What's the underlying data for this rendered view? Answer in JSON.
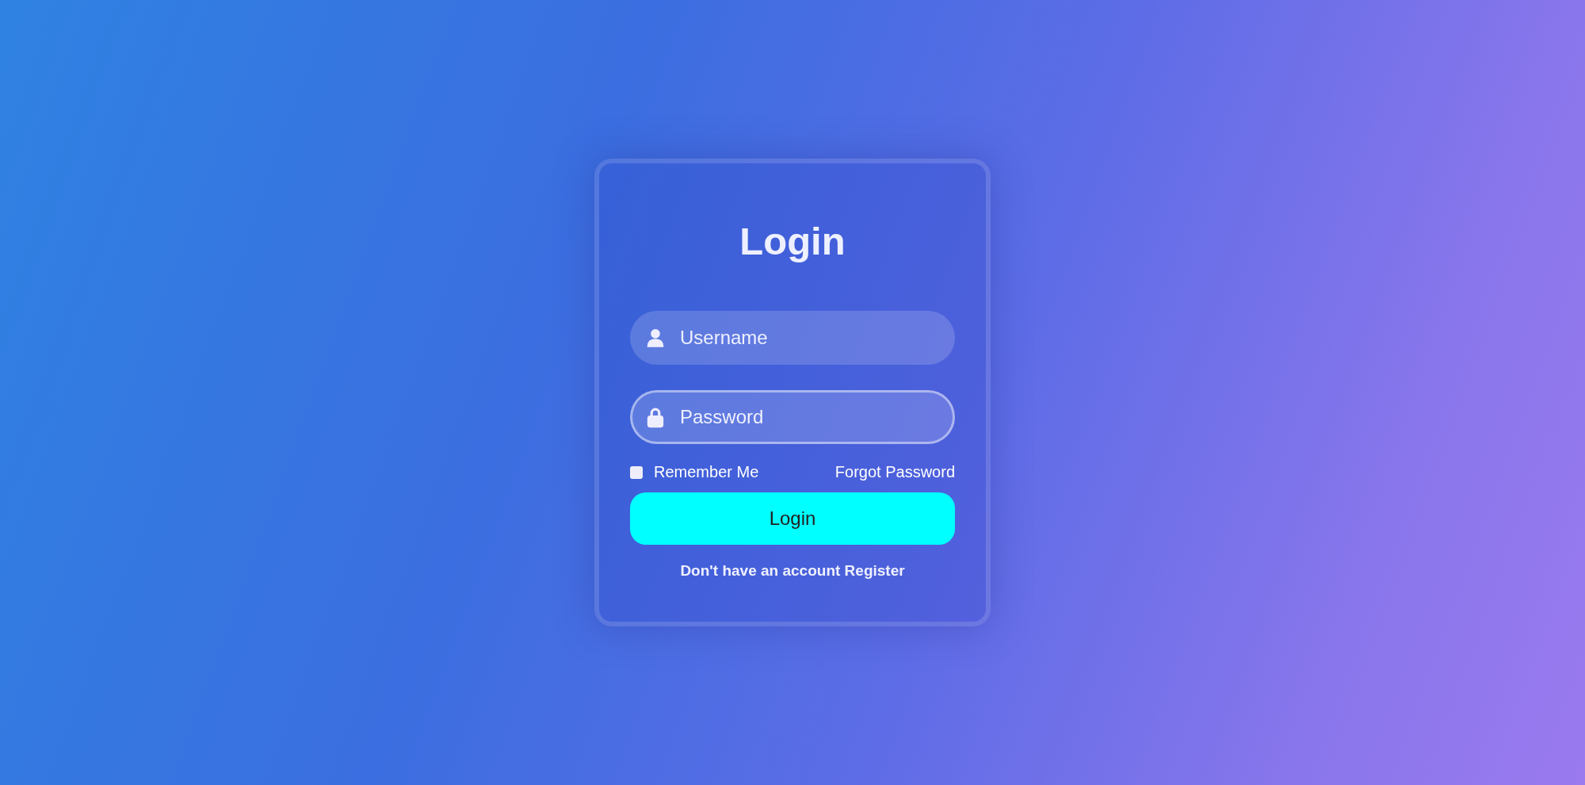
{
  "title": "Login",
  "fields": [
    {
      "kind": "user",
      "placeholder": "Username",
      "focused": false
    },
    {
      "kind": "lock",
      "placeholder": "Password",
      "focused": true
    }
  ],
  "remember": {
    "label": "Remember Me",
    "checked": false
  },
  "forgot_link": "Forgot Password",
  "login_button": "Login",
  "register": {
    "text": "Don't have an account",
    "link": "Register"
  }
}
